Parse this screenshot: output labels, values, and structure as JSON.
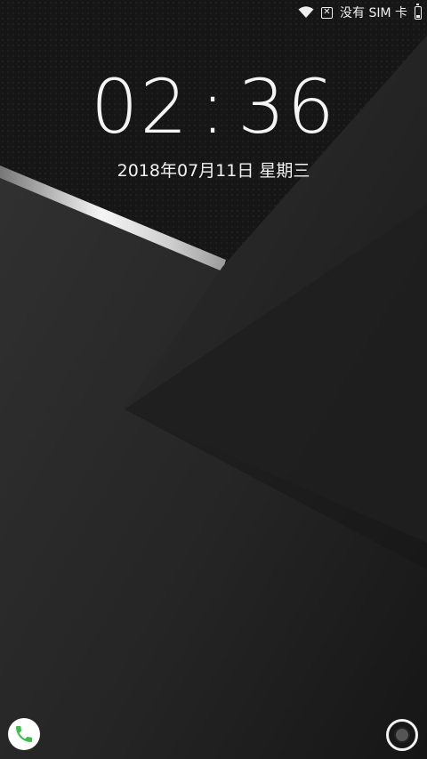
{
  "status_bar": {
    "carrier_text": "没有 SIM 卡",
    "icons": [
      "wifi-icon",
      "no-sim-icon",
      "battery-icon"
    ]
  },
  "lock_screen": {
    "time_hours": "02",
    "time_separator": ":",
    "time_minutes": "36",
    "date": "2018年07月11日 星期三"
  },
  "shortcuts": {
    "left": "phone-icon",
    "right": "camera-icon"
  },
  "colors": {
    "phone_green": "#3dbd4a",
    "background": "#1f1f1f"
  }
}
